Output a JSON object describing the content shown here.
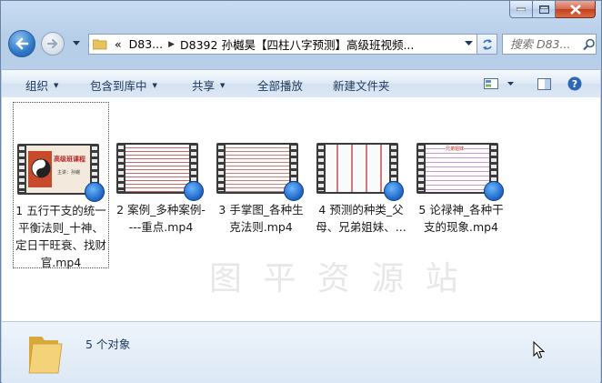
{
  "window": {
    "caption": {
      "minimize_icon": "minimize-icon",
      "maximize_icon": "maximize-icon",
      "close_icon": "close-icon"
    }
  },
  "navigation": {
    "address": {
      "overflow": "«",
      "crumbs": [
        "D83...",
        "D8392 孙樾昊【四柱八字预测】高级班视频..."
      ]
    },
    "search": {
      "placeholder": "搜索 D83..."
    }
  },
  "toolbar": {
    "organize": "组织",
    "include_in_library": "包含到库中",
    "share": "共享",
    "play_all": "全部播放",
    "new_folder": "新建文件夹"
  },
  "files": [
    {
      "name": "1 五行干支的统一平衡法则_十神、定日干旺衰、找财官.mp4",
      "selected": true
    },
    {
      "name": "2 案例_多种案例----重点.mp4",
      "selected": false
    },
    {
      "name": "3 手掌图_各种生克法则.mp4",
      "selected": false
    },
    {
      "name": "4 预测的种类_父母、兄弟姐妹、...",
      "selected": false
    },
    {
      "name": "5 论禄神_各种干支的现象.mp4",
      "selected": false
    }
  ],
  "thumbnail_texts": {
    "t1_title": "高级班课程",
    "t1_sub": "主讲：孙樾",
    "t5_title": "兄弟姐妹"
  },
  "details": {
    "count": "5 个对象"
  },
  "colors": {
    "accent": "#2f78c8",
    "close": "#c33f20"
  }
}
